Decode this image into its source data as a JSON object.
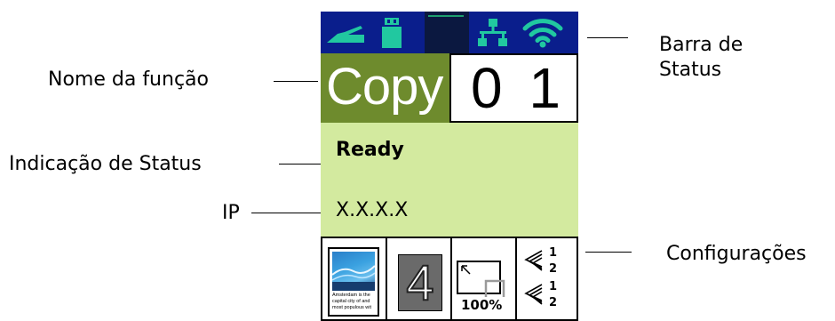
{
  "callouts": {
    "status_bar": "Barra de\nStatus",
    "function_name": "Nome da função",
    "status_indication": "Indicação de Status",
    "ip": "IP",
    "settings": "Configurações"
  },
  "screen": {
    "function_name": "Copy",
    "copy_count": "0 1",
    "status": "Ready",
    "ip": "X.X.X.X",
    "density": "4",
    "zoom": "100%",
    "thumbnail_text": "Amsterdam is the capital city of and most populous wit"
  },
  "icons": {
    "status_bar": [
      "scanner-icon",
      "usb-drive-icon",
      "network-icon",
      "wifi-icon"
    ],
    "settings": [
      "document-type-icon",
      "density-icon",
      "zoom-icon",
      "collate-icon"
    ]
  },
  "colors": {
    "status_bar": "#0a1e8c",
    "function_name_bg": "#6e8b2d",
    "status_area_bg": "#d3ea9f",
    "icon_green": "#21c8a0",
    "density_bg": "#6a6a6a"
  }
}
